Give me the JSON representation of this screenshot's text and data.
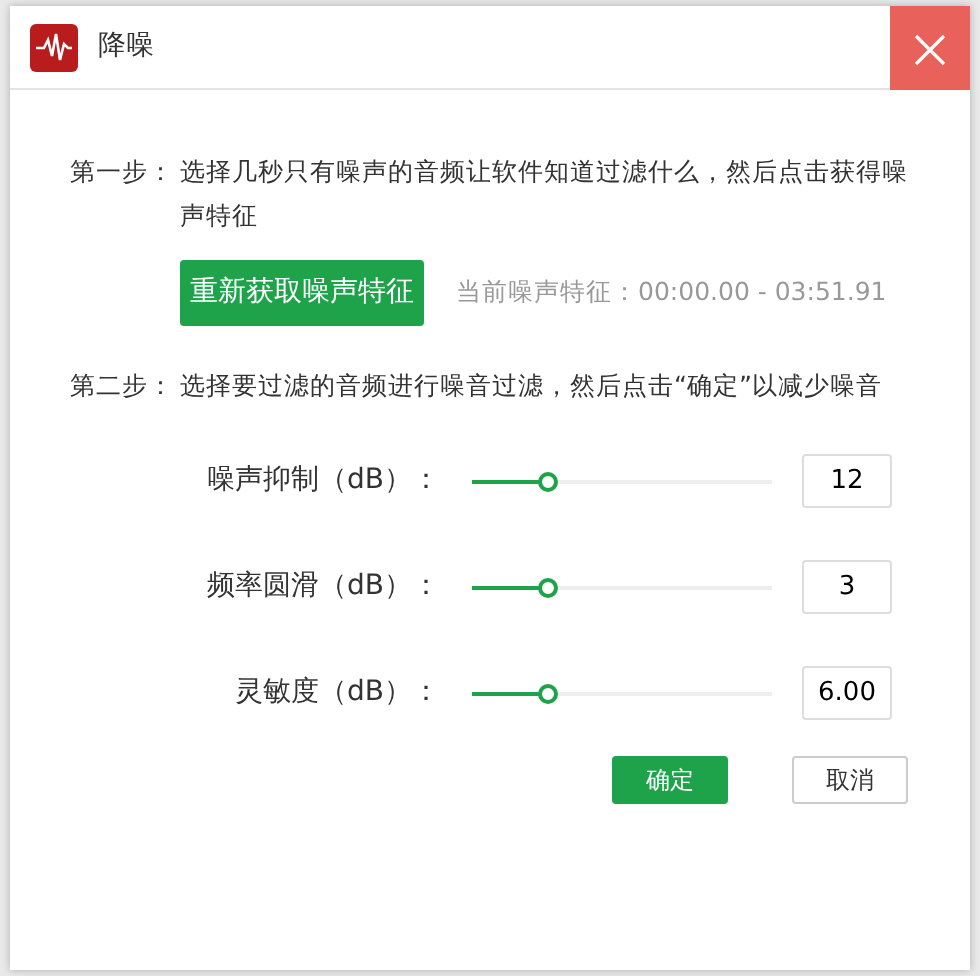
{
  "window": {
    "title": "降噪"
  },
  "steps": [
    {
      "label": "第一步：",
      "text": "选择几秒只有噪声的音频让软件知道过滤什么，然后点击获得噪声特征"
    },
    {
      "label": "第二步：",
      "text": "选择要过滤的音频进行噪音过滤，然后点击“确定”以减少噪音"
    }
  ],
  "capture": {
    "button": "重新获取噪声特征",
    "current": "当前噪声特征：00:00.00 - 03:51.91"
  },
  "sliders": [
    {
      "label": "噪声抑制（dB）：",
      "level": 0.25,
      "value": "12"
    },
    {
      "label": "频率圆滑（dB）：",
      "level": 0.25,
      "value": "3"
    },
    {
      "label": "灵敏度（dB）：",
      "level": 0.25,
      "value": "6.00"
    }
  ],
  "buttons": [
    {
      "label": "确定",
      "kind": "primary"
    },
    {
      "label": "取消",
      "kind": "secondary"
    }
  ]
}
